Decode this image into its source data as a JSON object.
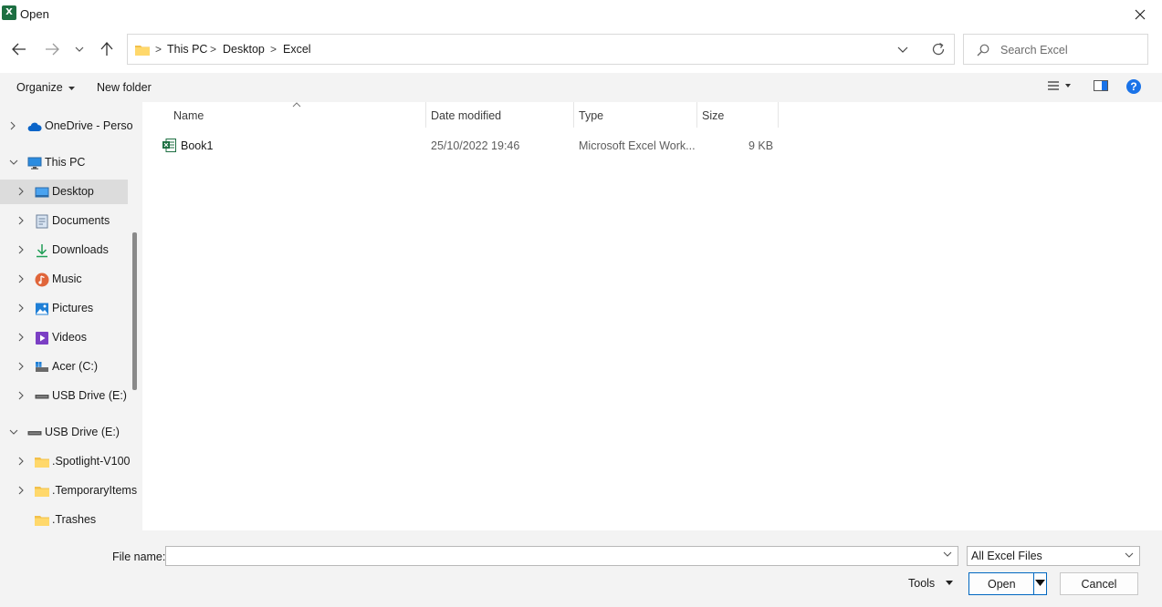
{
  "window": {
    "title": "Open",
    "app_icon_letter": "X",
    "accent": "#1d6f42"
  },
  "address": {
    "breadcrumbs": [
      "This PC",
      "Desktop",
      "Excel"
    ],
    "separator": ">"
  },
  "search": {
    "placeholder": "Search Excel",
    "value": ""
  },
  "toolbar": {
    "organize_label": "Organize",
    "new_folder_label": "New folder",
    "help_glyph": "?"
  },
  "nav_pane": {
    "items": [
      {
        "label": "OneDrive - Perso",
        "icon": "cloud-icon",
        "expanded": false
      },
      {
        "label": "This PC",
        "icon": "monitor-icon",
        "expanded": true
      },
      {
        "label": "Desktop",
        "icon": "desktop-icon",
        "selected": true
      },
      {
        "label": "Documents",
        "icon": "documents-icon"
      },
      {
        "label": "Downloads",
        "icon": "download-icon"
      },
      {
        "label": "Music",
        "icon": "music-icon"
      },
      {
        "label": "Pictures",
        "icon": "pictures-icon"
      },
      {
        "label": "Videos",
        "icon": "videos-icon"
      },
      {
        "label": "Acer (C:)",
        "icon": "drive-icon"
      },
      {
        "label": "USB Drive (E:)",
        "icon": "usb-drive-icon"
      },
      {
        "label": "USB Drive (E:)",
        "icon": "usb-drive-icon",
        "expanded": true
      },
      {
        "label": ".Spotlight-V100",
        "icon": "folder-icon"
      },
      {
        "label": ".TemporaryItems",
        "icon": "folder-icon"
      },
      {
        "label": ".Trashes",
        "icon": "folder-icon"
      }
    ]
  },
  "file_list": {
    "columns": [
      "Name",
      "Date modified",
      "Type",
      "Size"
    ],
    "rows": [
      {
        "name": "Book1",
        "date_modified": "25/10/2022 19:46",
        "type": "Microsoft Excel Work...",
        "size": "9 KB",
        "icon": "excel-file-icon"
      }
    ]
  },
  "bottom": {
    "file_name_label": "File name:",
    "file_name_value": "",
    "file_type_selected": "All Excel Files",
    "tools_label": "Tools",
    "open_label": "Open",
    "cancel_label": "Cancel"
  }
}
